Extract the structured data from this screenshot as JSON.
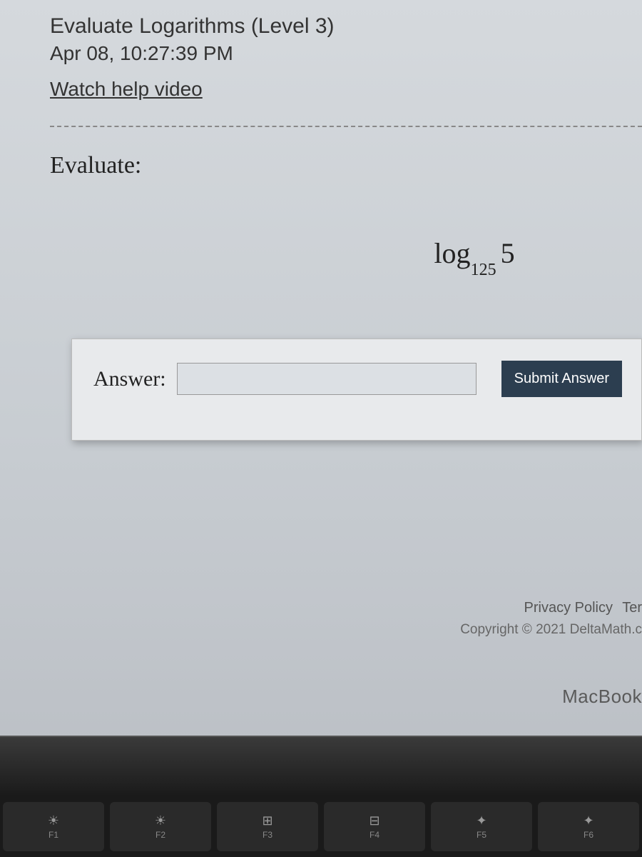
{
  "header": {
    "title": "Evaluate Logarithms (Level 3)",
    "timestamp": "Apr 08, 10:27:39 PM",
    "help_video": "Watch help video"
  },
  "problem": {
    "instruction": "Evaluate:",
    "expression": {
      "function": "log",
      "base": "125",
      "argument": "5"
    }
  },
  "answer_section": {
    "label": "Answer:",
    "input_value": "",
    "submit_label": "Submit Answer"
  },
  "footer": {
    "privacy": "Privacy Policy",
    "terms_partial": "Ter",
    "copyright": "Copyright © 2021 DeltaMath.c"
  },
  "device": {
    "label": "MacBook"
  },
  "keyboard": {
    "keys": [
      {
        "icon": "☀",
        "label": "F1"
      },
      {
        "icon": "☀",
        "label": "F2"
      },
      {
        "icon": "⊞",
        "label": "F3"
      },
      {
        "icon": "⊟",
        "label": "F4"
      },
      {
        "icon": "✦",
        "label": "F5"
      },
      {
        "icon": "✦",
        "label": "F6"
      }
    ]
  }
}
